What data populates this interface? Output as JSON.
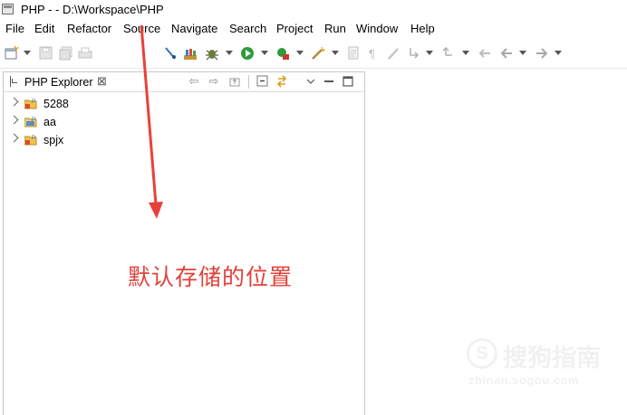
{
  "window": {
    "title": "PHP -  - D:\\Workspace\\PHP"
  },
  "menubar": {
    "items": [
      "File",
      "Edit",
      "Refactor",
      "Source",
      "Navigate",
      "Search",
      "Project",
      "Run",
      "Window",
      "Help"
    ]
  },
  "explorer": {
    "tab_label": "PHP Explorer",
    "close_glyph": "⊠",
    "projects": [
      {
        "label": "5288"
      },
      {
        "label": "aa"
      },
      {
        "label": "spjx"
      }
    ]
  },
  "annotation": {
    "text": "默认存储的位置",
    "color": "#e0403a"
  },
  "watermark": {
    "symbol": "S",
    "text": "搜狗指南",
    "url": "zhinan.sogou.com"
  },
  "colors": {
    "accent_arrow": "#e8413b",
    "run_green": "#2e9a3a"
  }
}
